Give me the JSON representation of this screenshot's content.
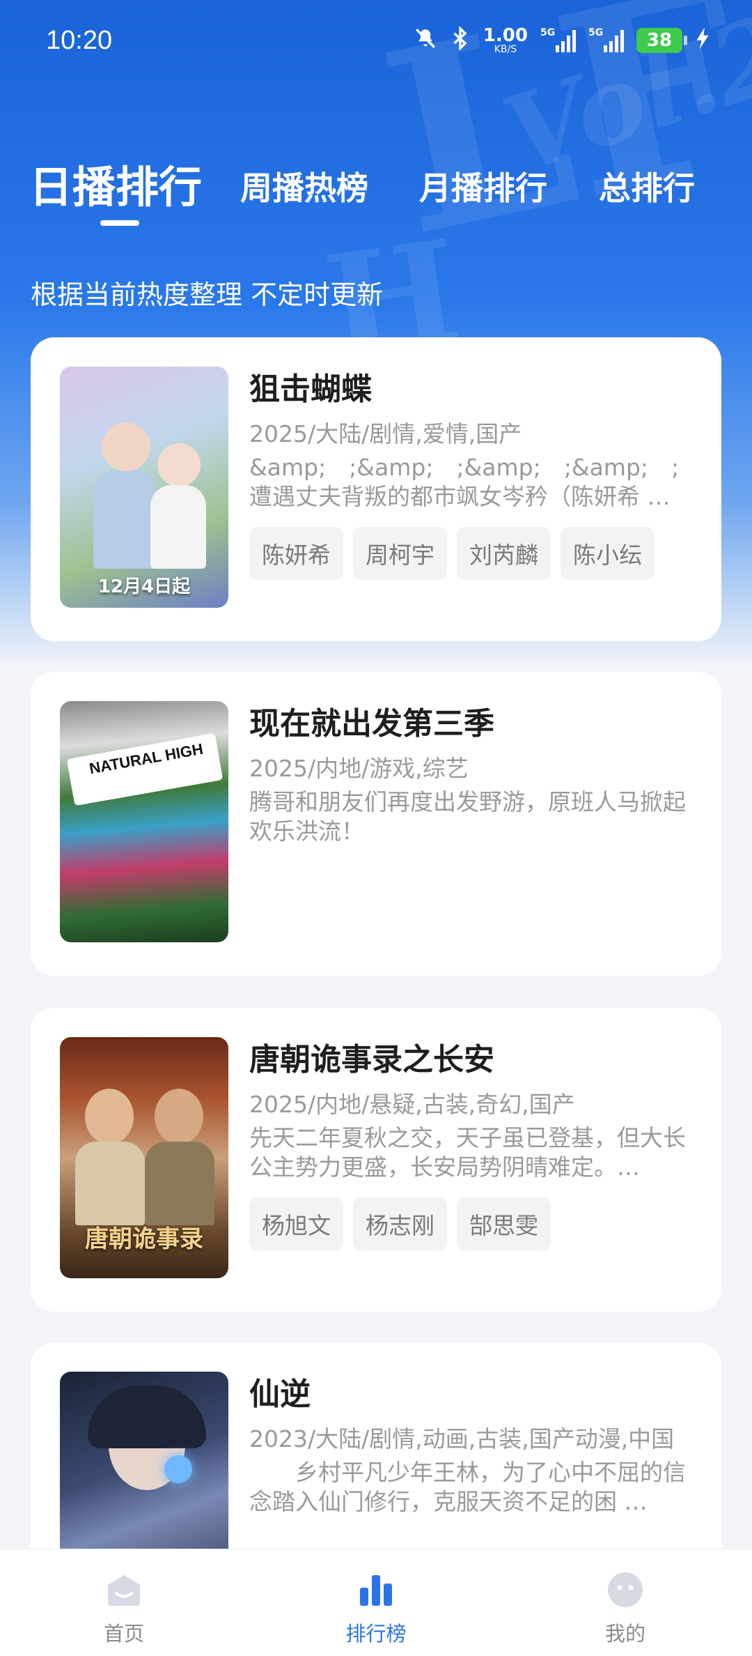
{
  "status_bar": {
    "time": "10:20",
    "net_speed_value": "1.00",
    "net_speed_unit": "KB/S",
    "signal1_label": "5G",
    "signal2_label": "5G",
    "battery": "38"
  },
  "tabs": [
    {
      "label": "日播排行",
      "active": true
    },
    {
      "label": "周播热榜",
      "active": false
    },
    {
      "label": "月播排行",
      "active": false
    },
    {
      "label": "总排行",
      "active": false
    }
  ],
  "subtitle": "根据当前热度整理 不定时更新",
  "items": [
    {
      "title": "狙击蝴蝶",
      "meta": "2025/大陆/剧情,爱情,国产",
      "desc": "&amp;　;&amp;　;&amp;　;&amp;　;遭遇丈夫背叛的都市飒女岑矜（陈妍希 …",
      "tags": [
        "陈妍希",
        "周柯宇",
        "刘芮麟",
        "陈小纭"
      ],
      "poster_text": "12月4日起"
    },
    {
      "title": "现在就出发第三季",
      "meta": "2025/内地/游戏,综艺",
      "desc": "腾哥和朋友们再度出发野游，原班人马掀起欢乐洪流！",
      "tags": [],
      "poster_text": "NATURAL HIGH"
    },
    {
      "title": "唐朝诡事录之长安",
      "meta": "2025/内地/悬疑,古装,奇幻,国产",
      "desc": "先天二年夏秋之交，天子虽已登基，但大长公主势力更盛，长安局势阴晴难定。…",
      "tags": [
        "杨旭文",
        "杨志刚",
        "郜思雯"
      ],
      "poster_text": "唐朝诡事录"
    },
    {
      "title": "仙逆",
      "meta": "2023/大陆/剧情,动画,古装,国产动漫,中国",
      "desc": "　　乡村平凡少年王林，为了心中不屈的信念踏入仙门修行，克服天资不足的困 …",
      "tags": [],
      "poster_text": ""
    }
  ],
  "bottom_nav": [
    {
      "label": "首页",
      "icon": "home-icon",
      "active": false
    },
    {
      "label": "排行榜",
      "icon": "bar-chart-icon",
      "active": true
    },
    {
      "label": "我的",
      "icon": "face-icon",
      "active": false
    }
  ]
}
